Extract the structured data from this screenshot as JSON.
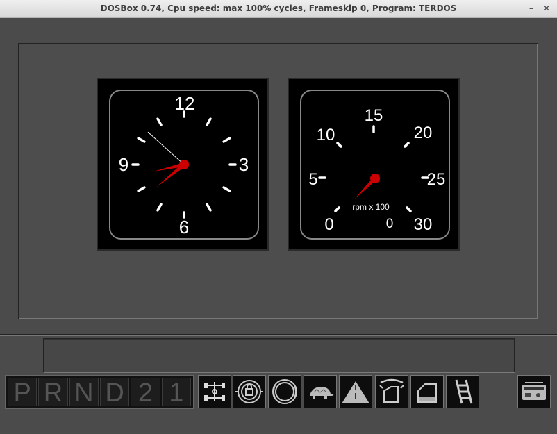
{
  "window": {
    "title": "DOSBox 0.74, Cpu speed: max 100% cycles, Frameskip  0, Program:   TERDOS",
    "minimize_glyph": "–",
    "close_glyph": "✕"
  },
  "clock": {
    "numerals": [
      "12",
      "3",
      "6",
      "9"
    ],
    "time": {
      "hour": 7,
      "minute": 42,
      "second": 52
    },
    "hand_color": "#cc0000"
  },
  "tachometer": {
    "scale_labels": [
      "0",
      "5",
      "10",
      "15",
      "20",
      "25",
      "30"
    ],
    "unit_label": "rpm x 100",
    "reading": "0",
    "needle_value": 0,
    "needle_color": "#cc0000"
  },
  "message_bar": {
    "text": ""
  },
  "gear_selector": {
    "gears": [
      "P",
      "R",
      "N",
      "D",
      "2",
      "1"
    ]
  },
  "controls": [
    {
      "icon": "axle-diagram-icon"
    },
    {
      "icon": "brake-warning-icon"
    },
    {
      "icon": "steering-wheel-icon"
    },
    {
      "icon": "turtle-icon"
    },
    {
      "icon": "road-icon"
    },
    {
      "icon": "car-door-icon"
    },
    {
      "icon": "door-open-icon"
    },
    {
      "icon": "ladder-icon"
    }
  ],
  "radio": {
    "icon": "radio-icon"
  }
}
